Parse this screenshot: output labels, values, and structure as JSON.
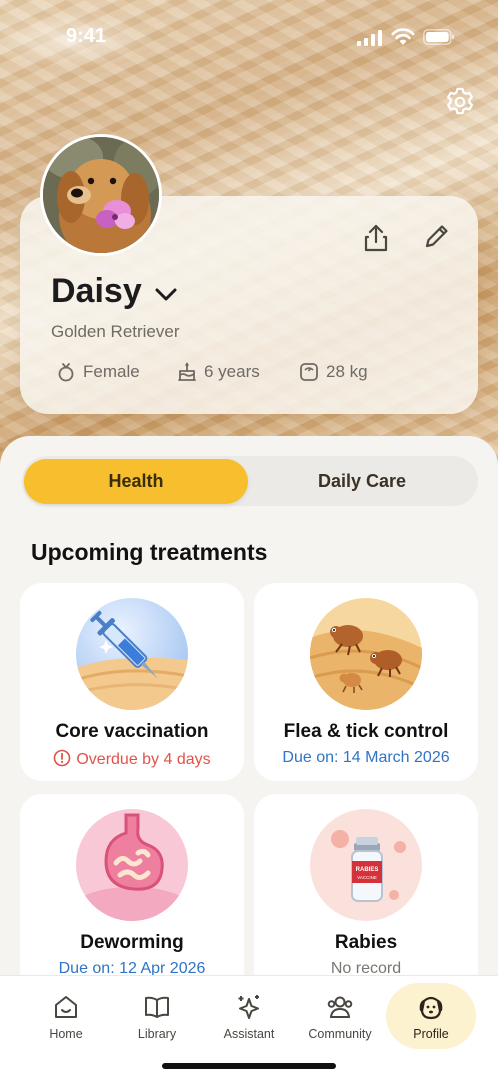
{
  "status_bar": {
    "time": "9:41"
  },
  "profile": {
    "name": "Daisy",
    "breed": "Golden Retriever",
    "sex": "Female",
    "age": "6 years",
    "weight": "28 kg"
  },
  "tabs": {
    "health": "Health",
    "daily_care": "Daily Care",
    "active": "Health"
  },
  "section_title": "Upcoming treatments",
  "treatments": [
    {
      "title": "Core vaccination",
      "status": "Overdue by 4 days",
      "state": "overdue"
    },
    {
      "title": "Flea & tick control",
      "status": "Due on: 14 March 2026",
      "state": "due"
    },
    {
      "title": "Deworming",
      "status": "Due on: 12 Apr 2026",
      "state": "due"
    },
    {
      "title": "Rabies",
      "status": "No record",
      "state": "none"
    }
  ],
  "rabies_vial_label": "RABIES",
  "rabies_vial_sublabel": "VACCINE",
  "nav": [
    {
      "label": "Home",
      "icon": "home-icon"
    },
    {
      "label": "Library",
      "icon": "book-icon"
    },
    {
      "label": "Assistant",
      "icon": "sparkle-icon"
    },
    {
      "label": "Community",
      "icon": "people-icon"
    },
    {
      "label": "Profile",
      "icon": "dog-icon",
      "active": true
    }
  ],
  "colors": {
    "accent": "#f7bf2e",
    "overdue": "#e2524a",
    "due": "#2f74c6",
    "active_nav_bg": "#fdf2cf"
  }
}
